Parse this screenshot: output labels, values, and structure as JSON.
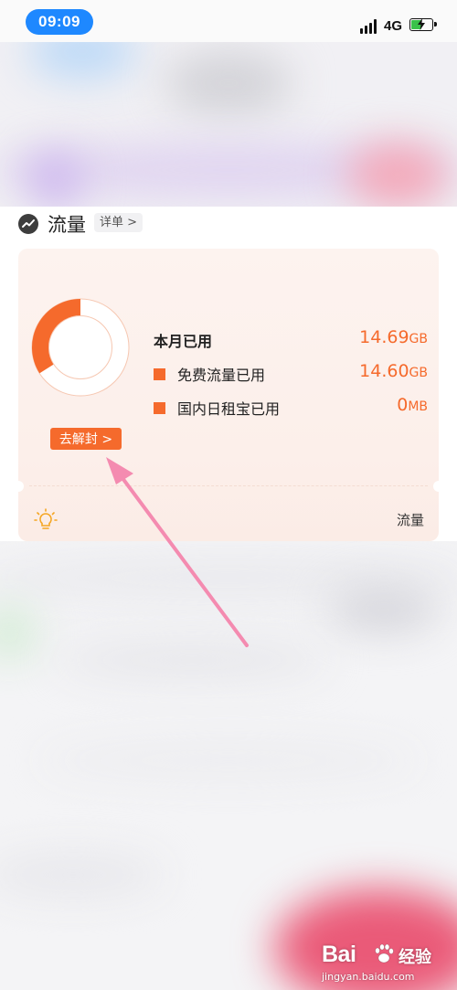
{
  "status_bar": {
    "time": "09:09",
    "network": "4G",
    "battery_level": 0.48,
    "battery_charging": true,
    "accent": "#1e88ff"
  },
  "section": {
    "title": "流量",
    "detail_label": "详单 >",
    "icon": "trend-icon"
  },
  "usage": {
    "total_label": "本月已用",
    "total_value": "14.69",
    "total_unit": "GB",
    "rows": [
      {
        "label": "免费流量已用",
        "value": "14.60",
        "unit": "GB"
      },
      {
        "label": "国内日租宝已用",
        "value": "0",
        "unit": "MB"
      }
    ],
    "used_fraction": 0.34,
    "unseal_button": "去解封 >",
    "accent": "#f56a2c"
  },
  "tip": {
    "icon": "lightbulb-icon",
    "label": "流量"
  },
  "watermark": {
    "brand": "Bai",
    "brand_tail": "经验",
    "url": "jingyan.baidu.com"
  }
}
